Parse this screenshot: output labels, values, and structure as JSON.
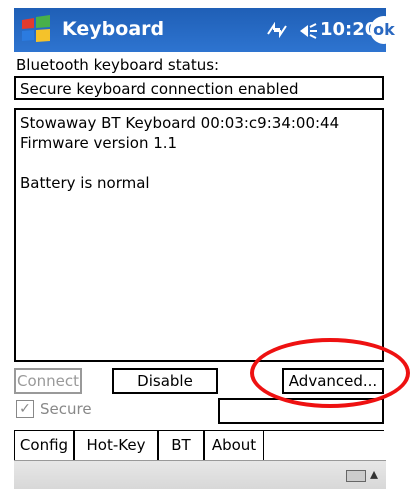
{
  "window": {
    "title": "Keyboard",
    "time": "10:20",
    "ok_label": "ok"
  },
  "status": {
    "label": "Bluetooth keyboard status:",
    "value": "Secure keyboard connection enabled"
  },
  "info": {
    "lines": [
      "Stowaway BT Keyboard 00:03:c9:34:00:44",
      "Firmware version 1.1",
      "",
      "Battery is normal"
    ]
  },
  "buttons": {
    "connect": "Connect",
    "disable": "Disable",
    "advanced": "Advanced..."
  },
  "secure": {
    "label": "Secure",
    "checked": true
  },
  "tabs": [
    "Config",
    "Hot-Key",
    "BT",
    "About"
  ],
  "active_tab": "BT",
  "icons": {
    "logo": "windows-logo-icon",
    "sync": "sync-icon",
    "speaker": "speaker-icon",
    "keyboard": "keyboard-icon",
    "arrow": "up-arrow-icon"
  },
  "colors": {
    "titlebar": "#2a68c0",
    "highlight": "#e11111"
  }
}
